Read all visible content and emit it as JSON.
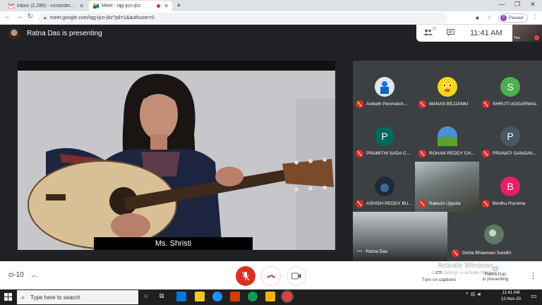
{
  "browser": {
    "tabs": [
      {
        "title": "Inbox (2,286) - cicoordinator@",
        "favicon": "gmail-icon",
        "active": false
      },
      {
        "title": "Meet - iqg-ijcn-jbz",
        "favicon": "meet-icon",
        "active": true,
        "recording": true
      }
    ],
    "new_tab": "+",
    "url": "meet.google.com/iqg-ijcn-jbz?pli=1&authuser=0",
    "profile_status": "Paused",
    "profile_initial": "C"
  },
  "meet": {
    "presenting_label": "Ratna Das is presenting",
    "participant_count": "13",
    "time": "11:41 AM",
    "self_label": "You",
    "subtitle": "Ms. Shristi",
    "participants": [
      {
        "name": "Aniketh Penmetch...",
        "avatar": "photo",
        "color": "#1a73e8"
      },
      {
        "name": "MANAS BEJJANKI",
        "avatar": "photo",
        "color": "#f9d71c"
      },
      {
        "name": "SHRUTI AGGARWAL",
        "avatar": "S",
        "color": "#4caf50"
      },
      {
        "name": "PRAMITHI SADA C...",
        "avatar": "P",
        "color": "#00695c"
      },
      {
        "name": "ROHAN REDDY CH...",
        "avatar": "photo",
        "color": "#4a90d9"
      },
      {
        "name": "PRANATI GANGAV...",
        "avatar": "P",
        "color": "#455a64"
      },
      {
        "name": "ASHISH REDDY BU...",
        "avatar": "photo",
        "color": "#1c2a3a"
      },
      {
        "name": "Rakesh Uppula",
        "avatar": "video",
        "color": "#6f7a79"
      },
      {
        "name": "Bindhu Purnima",
        "avatar": "B",
        "color": "#e91e63"
      },
      {
        "name": "Ratna Das",
        "avatar": "video",
        "color": "#6c7274"
      },
      {
        "name": "Disha Bhawnani Sandhi",
        "avatar": "photo",
        "color": "#5d7a64"
      }
    ]
  },
  "bottom": {
    "meeting_code": "ci-10",
    "activate_windows": "Activate Windows",
    "activate_sub": "Go to Settings to activate Windows.",
    "captions": "Turn on captions",
    "presenting_line1": "Ratna Das",
    "presenting_line2": "is presenting"
  },
  "taskbar": {
    "search_placeholder": "Type here to search",
    "time": "11:41 AM",
    "date": "12-Nov-20"
  }
}
